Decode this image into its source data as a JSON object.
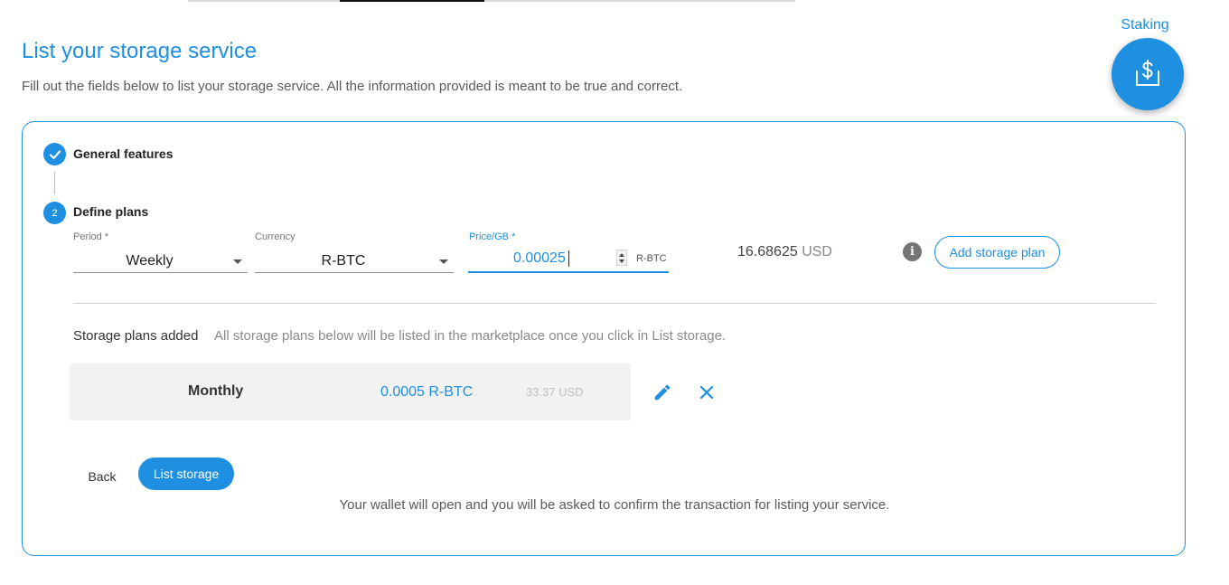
{
  "header": {
    "title": "List your storage service",
    "subtitle": "Fill out the fields below to list your storage service. All the information provided is meant to be true and correct."
  },
  "staking": {
    "label": "Staking",
    "icon": "dollar-wallet-icon"
  },
  "steps": [
    {
      "label": "General features",
      "state": "completed",
      "icon": "check-icon"
    },
    {
      "label": "Define plans",
      "state": "active",
      "number": "2"
    }
  ],
  "plan_form": {
    "period": {
      "label": "Period *",
      "value": "Weekly"
    },
    "currency": {
      "label": "Currency",
      "value": "R-BTC"
    },
    "price": {
      "label": "Price/GB *",
      "value": "0.00025",
      "unit": "R-BTC"
    },
    "usd_amount": "16.68625",
    "usd_currency": "USD",
    "info_icon": "info-icon",
    "add_button": "Add storage plan"
  },
  "plans_section": {
    "heading": "Storage plans added",
    "note": "All storage plans below will be listed in the marketplace once you click in List storage.",
    "plans": [
      {
        "period": "Monthly",
        "price": "0.0005 R-BTC",
        "usd": "33.37 USD"
      }
    ]
  },
  "actions": {
    "back": "Back",
    "list_storage": "List storage",
    "wallet_note": "Your wallet will open and you will be asked to confirm the transaction for listing your service."
  },
  "colors": {
    "accent": "#1e8fe1",
    "muted_text": "#5a5a5a",
    "plan_row_bg": "#f2f2f2"
  }
}
